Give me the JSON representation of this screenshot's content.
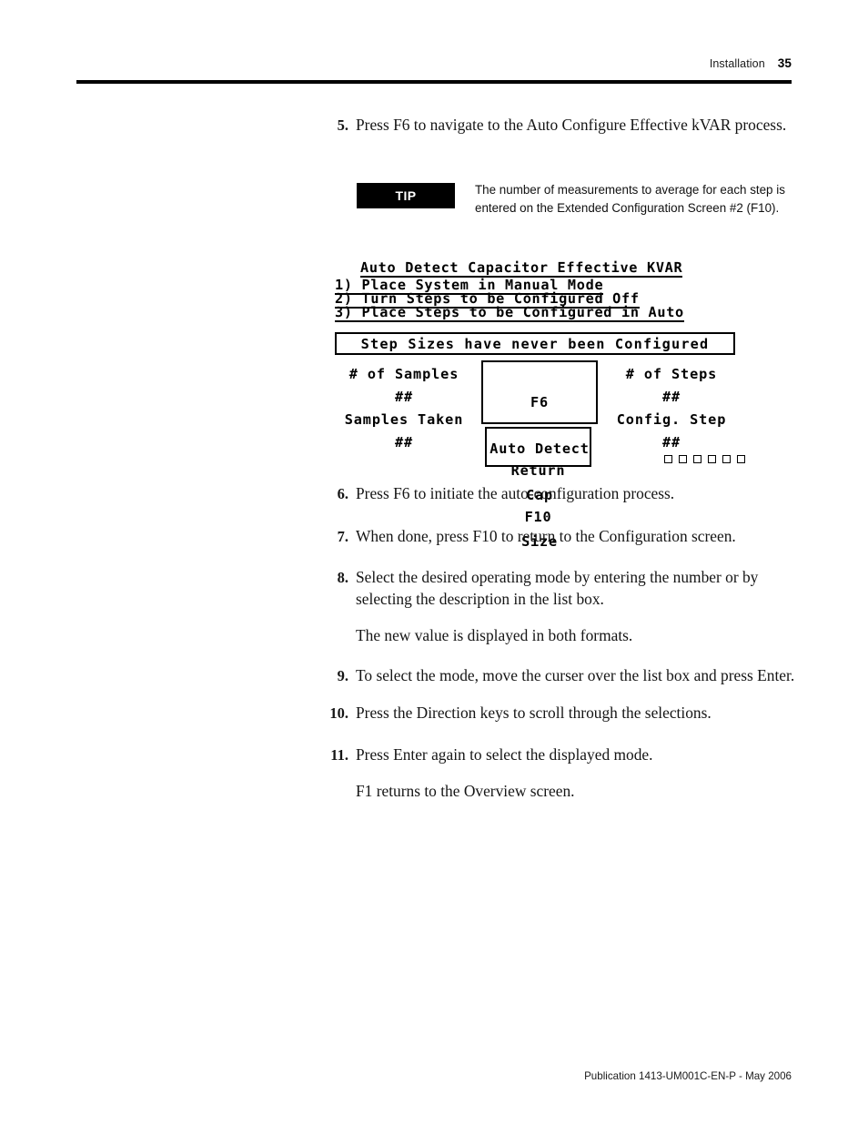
{
  "header": {
    "chapter": "Installation",
    "page_number": "35"
  },
  "tip": {
    "badge_label": "TIP",
    "text": "The number of measurements to average for each step is entered on the Extended Configuration Screen #2 (F10)."
  },
  "steps": [
    {
      "number": "5.",
      "text": "Press F6 to navigate to the Auto Configure Effective kVAR process."
    },
    {
      "number": "6.",
      "text": "Press F6 to initiate the auto-configuration process."
    },
    {
      "number": "7.",
      "text": "When done, press F10 to return to the Configuration screen."
    },
    {
      "number": "8.",
      "text": "Select the desired operating mode by entering the number or by selecting the description in the list box."
    },
    {
      "number": "9.",
      "text": "To select the mode, move the curser over the list box and press Enter."
    },
    {
      "number": "10.",
      "text": "Press the Direction keys to scroll through the selections."
    },
    {
      "number": "11.",
      "text": "Press Enter again to select the displayed mode."
    }
  ],
  "notes": {
    "after_step_8": "The new value is displayed in both formats.",
    "after_step_11": "F1 returns to the Overview screen."
  },
  "lcd_screen": {
    "title": "Auto Detect Capacitor Effective KVAR",
    "instruction_1": "1) Place System in Manual Mode",
    "instruction_2": "2) Turn Steps to be Configured Off",
    "instruction_3": "3) Place Steps to be Configured in Auto",
    "banner": "Step Sizes have never been Configured",
    "left_column": {
      "label_1": "# of Samples",
      "value_1": "##",
      "label_2": "Samples Taken",
      "value_2": "##"
    },
    "right_column": {
      "label_1": "# of Steps",
      "value_1": "##",
      "label_2": "Config. Step",
      "value_2": "##"
    },
    "key_f6": {
      "line_1": "F6",
      "line_2": "Auto Detect",
      "line_3": "Cap",
      "line_4": "Size"
    },
    "key_return": {
      "line_1": "Return",
      "line_2": "F10"
    },
    "step_indicator_count": 6
  },
  "footer": {
    "publication": "Publication 1413-UM001C-EN-P - May 2006"
  }
}
